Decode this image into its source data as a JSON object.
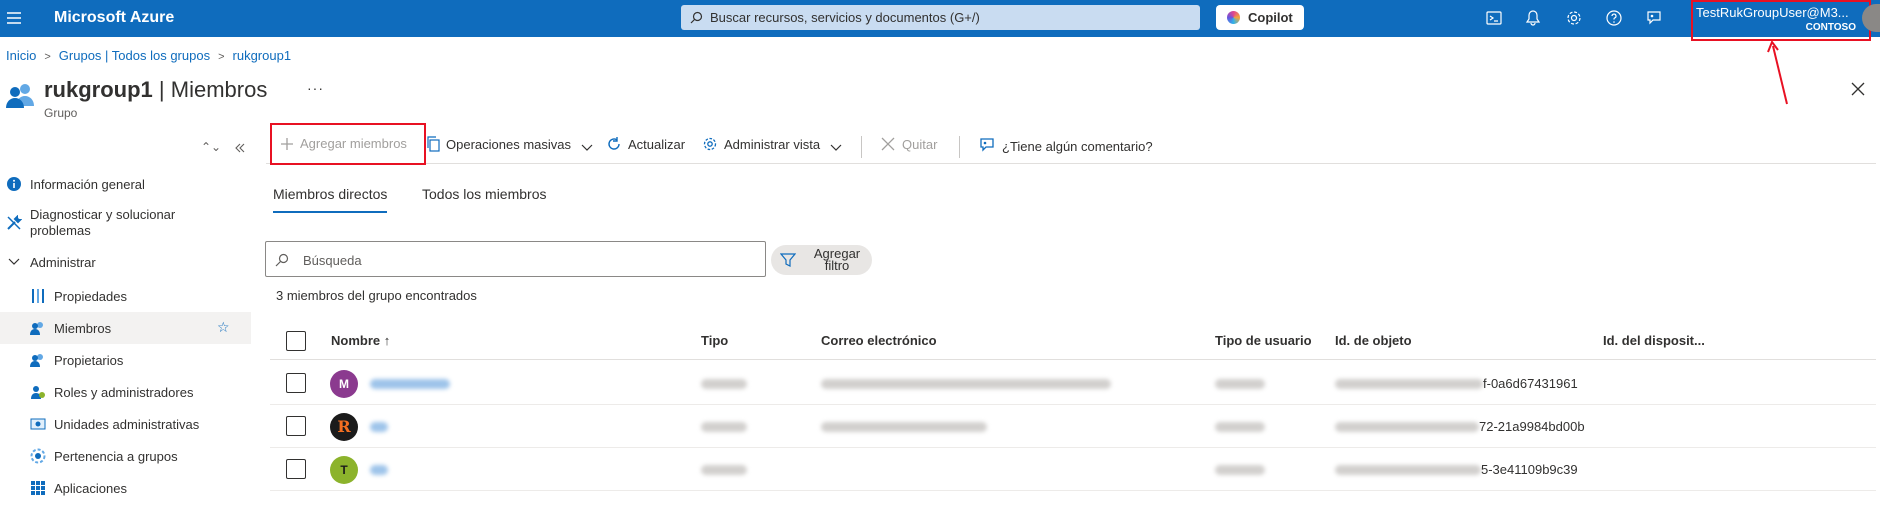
{
  "header": {
    "brand": "Microsoft Azure",
    "search_placeholder": "Buscar recursos, servicios y documentos (G+/)",
    "copilot_label": "Copilot",
    "account_user": "TestRukGroupUser@M3...",
    "account_org": "CONTOSO"
  },
  "breadcrumb": [
    "Inicio",
    "Grupos | Todos los grupos",
    "rukgroup1"
  ],
  "page": {
    "title_name": "rukgroup1",
    "title_section": "| Miembros",
    "subtitle": "Grupo",
    "more": "···"
  },
  "sidebar": {
    "items": [
      {
        "label": "Información general",
        "icon": "info-icon"
      },
      {
        "label": "Diagnosticar y solucionar problemas",
        "icon": "wrench-icon"
      },
      {
        "label": "Administrar",
        "icon": "chevron-down-icon"
      },
      {
        "label": "Propiedades",
        "icon": "properties-icon"
      },
      {
        "label": "Miembros",
        "icon": "members-icon",
        "active": true
      },
      {
        "label": "Propietarios",
        "icon": "owners-icon"
      },
      {
        "label": "Roles y administradores",
        "icon": "roles-icon"
      },
      {
        "label": "Unidades administrativas",
        "icon": "admin-units-icon"
      },
      {
        "label": "Pertenencia a grupos",
        "icon": "group-membership-icon"
      },
      {
        "label": "Aplicaciones",
        "icon": "apps-icon"
      }
    ]
  },
  "toolbar": {
    "add_members": "Agregar miembros",
    "bulk_ops": "Operaciones masivas",
    "refresh": "Actualizar",
    "manage_view": "Administrar vista",
    "remove": "Quitar",
    "feedback": "¿Tiene algún comentario?"
  },
  "tabs": [
    "Miembros directos",
    "Todos los miembros"
  ],
  "search": {
    "placeholder": "Búsqueda"
  },
  "filter": {
    "label_line1": "Agregar",
    "label_line2": "filtro"
  },
  "count_text": "3 miembros del grupo encontrados",
  "table": {
    "columns": [
      "Nombre ↑",
      "Tipo",
      "Correo electrónico",
      "Tipo de usuario",
      "Id. de objeto",
      "Id. del disposit..."
    ],
    "rows": [
      {
        "initial": "M",
        "avatar_color": "#8b3a8f",
        "object_id_tail": "f-0a6d67431961"
      },
      {
        "initial": "R",
        "avatar_color": "#1b1b1b",
        "object_id_tail": "72-21a9984bd00b"
      },
      {
        "initial": "T",
        "avatar_color": "#8cb32c",
        "object_id_tail": "5-3e41109b9c39"
      }
    ]
  },
  "colors": {
    "accent": "#0f6cbd",
    "highlight": "#e81123"
  }
}
